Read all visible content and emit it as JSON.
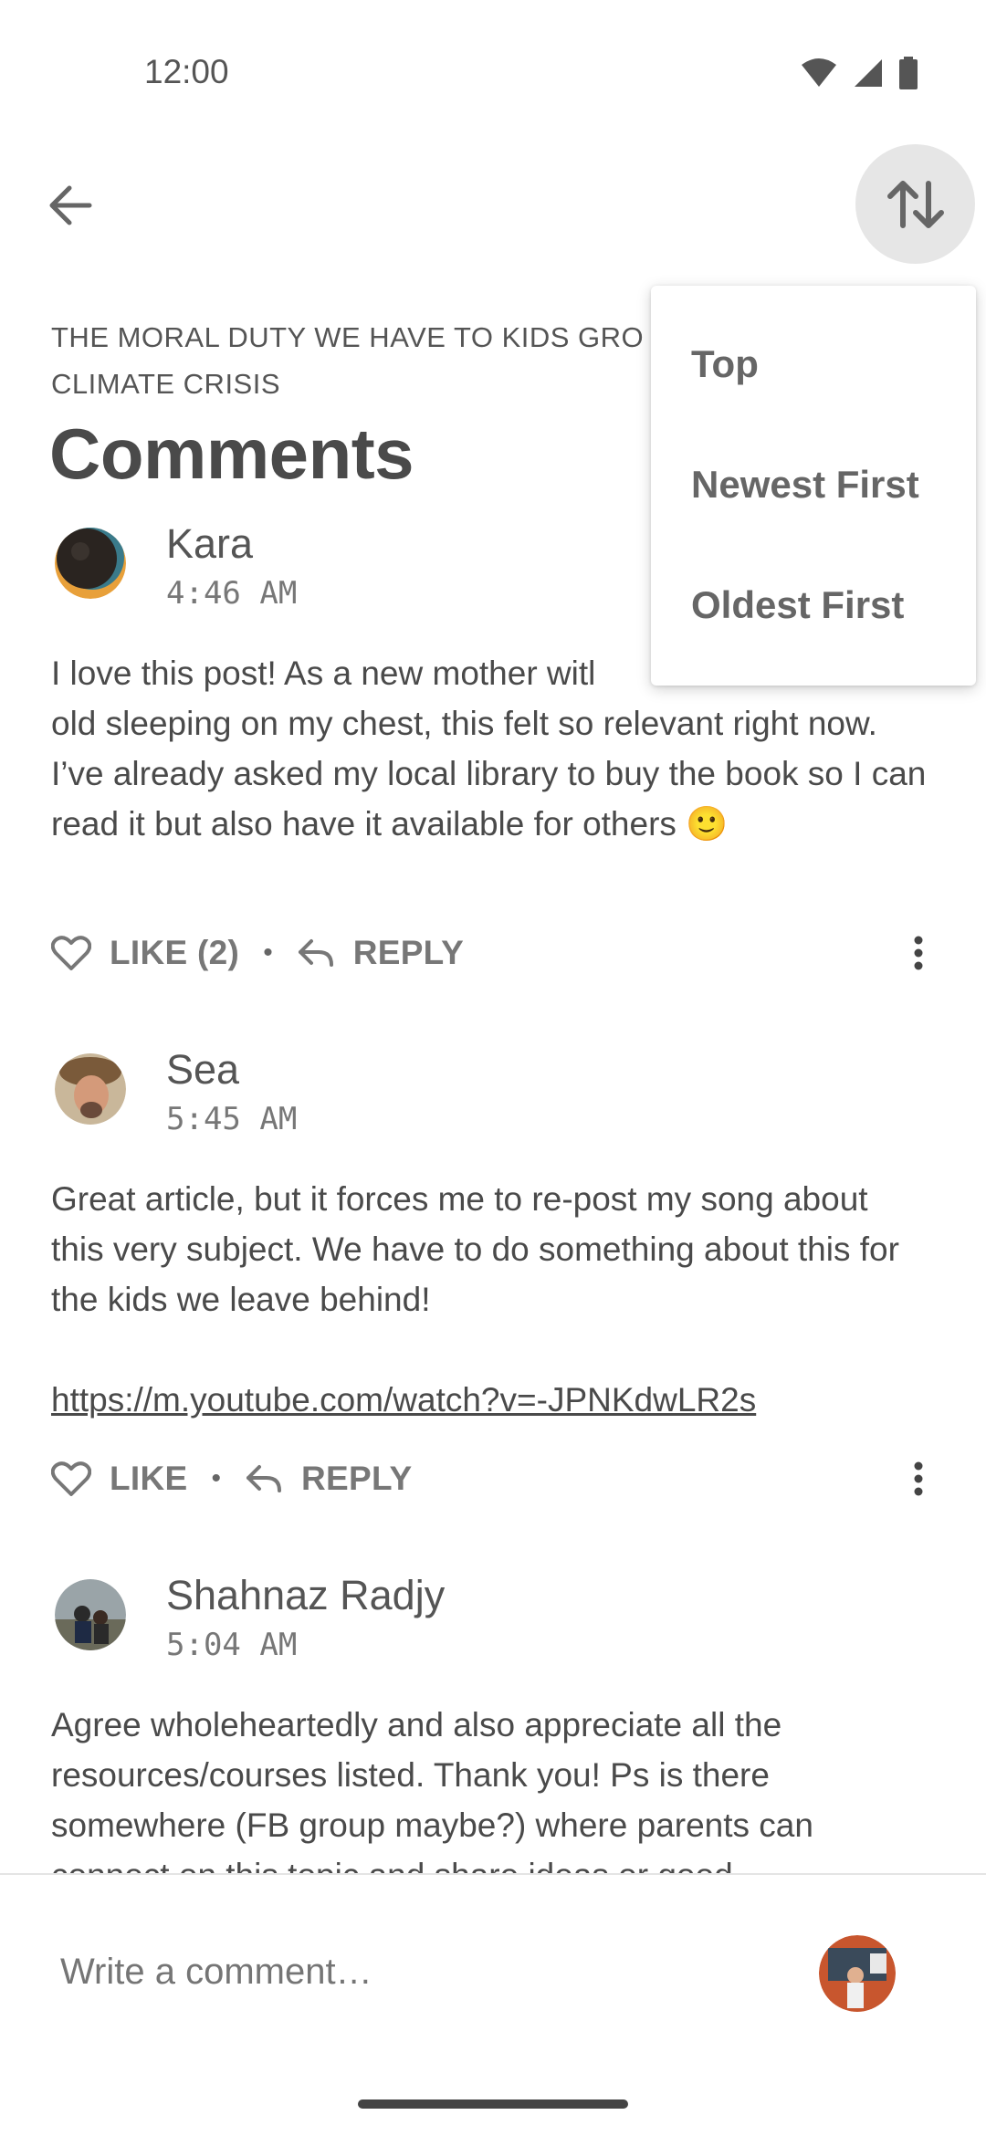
{
  "status_bar": {
    "time": "12:00",
    "icons": [
      "wifi-icon",
      "cell-signal-icon",
      "battery-icon"
    ]
  },
  "toolbar": {
    "back_icon": "arrow-left-icon",
    "sort_icon": "sort-arrows-icon"
  },
  "article": {
    "title": "THE MORAL DUTY WE HAVE TO KIDS GRO\nCLIMATE CRISIS"
  },
  "page": {
    "heading": "Comments"
  },
  "comments": [
    {
      "author": "Kara",
      "time": "4:46 AM",
      "body": "I love this post! As a new mother witl\nold sleeping on my chest, this felt so relevant right now. I’ve already asked my local library to buy the book so I can read it but also have it available for others 🙂",
      "like_label": "LIKE (2)",
      "reply_label": "REPLY"
    },
    {
      "author": "Sea",
      "time": "5:45 AM",
      "body": "Great article, but it forces me to re-post my song about this very subject. We have to do something about this for the kids we leave behind!",
      "link": "https://m.youtube.com/watch?v=-JPNKdwLR2s",
      "like_label": "LIKE",
      "reply_label": "REPLY"
    },
    {
      "author": "Shahnaz Radjy",
      "time": "5:04 AM",
      "body": "Agree wholeheartedly and also appreciate all the resources/courses listed. Thank you! Ps is there somewhere (FB group maybe?) where parents can connect on this topic and share ideas or good"
    }
  ],
  "actions": {
    "separator": "•"
  },
  "composer": {
    "placeholder": "Write a comment…"
  },
  "sort_menu": {
    "options": [
      "Top",
      "Newest First",
      "Oldest First"
    ]
  },
  "colors": {
    "text": "#4a4a4a",
    "muted": "#777777",
    "sort_button_bg": "#e6e6e6"
  }
}
